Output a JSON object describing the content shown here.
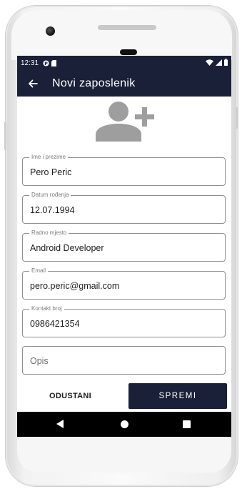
{
  "status_bar": {
    "time": "12:31",
    "left_icons": [
      "notification-icon",
      "sd-card-icon"
    ],
    "right_icons": [
      "wifi-icon",
      "signal-icon",
      "battery-icon"
    ]
  },
  "app_bar": {
    "title": "Novi zaposlenik",
    "nav_icon": "back-arrow-icon"
  },
  "header_icon": "add-person-icon",
  "form": {
    "fields": [
      {
        "label": "Ime i prezime",
        "value": "Pero Peric"
      },
      {
        "label": "Datum rođenja",
        "value": "12.07.1994"
      },
      {
        "label": "Radno mjesto",
        "value": "Android Developer"
      },
      {
        "label": "Email",
        "value": "pero.peric@gmail.com"
      },
      {
        "label": "Kontakt broj",
        "value": "0986421354"
      },
      {
        "label": "",
        "placeholder": "Opis",
        "value": ""
      }
    ]
  },
  "actions": {
    "cancel_label": "ODUSTANI",
    "save_label": "SPREMI"
  },
  "colors": {
    "primary": "#1a2037",
    "outline": "#8f8f8f",
    "icon_gray": "#9e9e9e"
  },
  "system_nav": [
    "nav-back-icon",
    "nav-home-icon",
    "nav-recents-icon"
  ]
}
